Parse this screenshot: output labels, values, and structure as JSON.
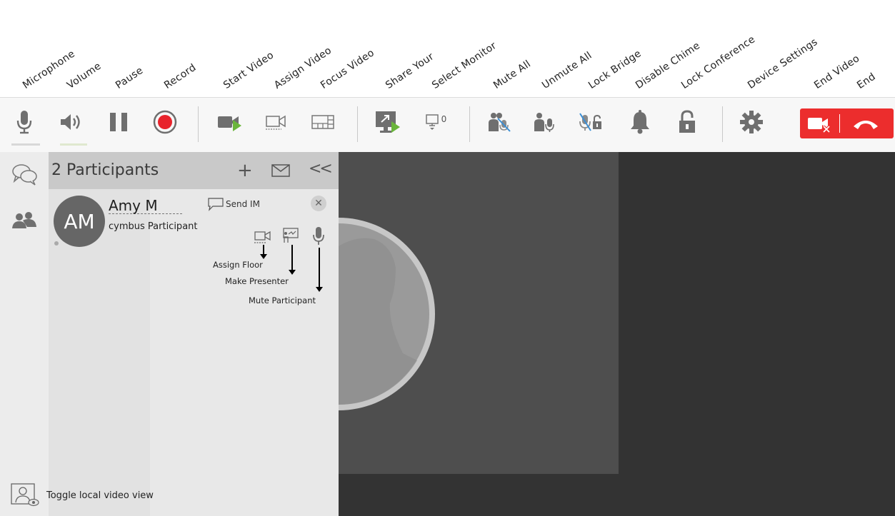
{
  "annotations": [
    "Microphone",
    "Volume",
    "Pause",
    "Record",
    "Start Video",
    "Assign Video",
    "Focus Video",
    "Share Your",
    "Select Monitor",
    "Mute All",
    "Unmute All",
    "Lock Bridge",
    "Disable Chime",
    "Lock Conference",
    "Device Settings",
    "End Video",
    "End"
  ],
  "toolbar": {
    "monitor_count": "0",
    "colors": {
      "record": "#e8232b",
      "video_green": "#6ab53b",
      "end_red": "#ec2d2d"
    }
  },
  "participants": {
    "title": "2 Participants",
    "add_icon": "+",
    "collapse_icon": "<<",
    "member": {
      "initials": "AM",
      "name": "Amy M",
      "role": "cymbus Participant",
      "send_im": "Send IM",
      "assign_floor": "Assign Floor",
      "make_presenter": "Make Presenter",
      "mute_participant": "Mute Participant"
    }
  },
  "footer": {
    "toggle_label": "Toggle local video view"
  }
}
